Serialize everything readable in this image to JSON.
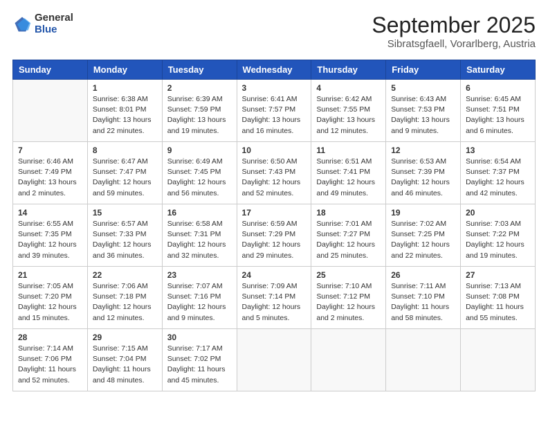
{
  "header": {
    "logo_general": "General",
    "logo_blue": "Blue",
    "month_title": "September 2025",
    "location": "Sibratsgfaell, Vorarlberg, Austria"
  },
  "calendar": {
    "weekdays": [
      "Sunday",
      "Monday",
      "Tuesday",
      "Wednesday",
      "Thursday",
      "Friday",
      "Saturday"
    ],
    "weeks": [
      [
        {
          "day": null
        },
        {
          "day": "1",
          "sunrise": "6:38 AM",
          "sunset": "8:01 PM",
          "daylight": "13 hours and 22 minutes."
        },
        {
          "day": "2",
          "sunrise": "6:39 AM",
          "sunset": "7:59 PM",
          "daylight": "13 hours and 19 minutes."
        },
        {
          "day": "3",
          "sunrise": "6:41 AM",
          "sunset": "7:57 PM",
          "daylight": "13 hours and 16 minutes."
        },
        {
          "day": "4",
          "sunrise": "6:42 AM",
          "sunset": "7:55 PM",
          "daylight": "13 hours and 12 minutes."
        },
        {
          "day": "5",
          "sunrise": "6:43 AM",
          "sunset": "7:53 PM",
          "daylight": "13 hours and 9 minutes."
        },
        {
          "day": "6",
          "sunrise": "6:45 AM",
          "sunset": "7:51 PM",
          "daylight": "13 hours and 6 minutes."
        }
      ],
      [
        {
          "day": "7",
          "sunrise": "6:46 AM",
          "sunset": "7:49 PM",
          "daylight": "13 hours and 2 minutes."
        },
        {
          "day": "8",
          "sunrise": "6:47 AM",
          "sunset": "7:47 PM",
          "daylight": "12 hours and 59 minutes."
        },
        {
          "day": "9",
          "sunrise": "6:49 AM",
          "sunset": "7:45 PM",
          "daylight": "12 hours and 56 minutes."
        },
        {
          "day": "10",
          "sunrise": "6:50 AM",
          "sunset": "7:43 PM",
          "daylight": "12 hours and 52 minutes."
        },
        {
          "day": "11",
          "sunrise": "6:51 AM",
          "sunset": "7:41 PM",
          "daylight": "12 hours and 49 minutes."
        },
        {
          "day": "12",
          "sunrise": "6:53 AM",
          "sunset": "7:39 PM",
          "daylight": "12 hours and 46 minutes."
        },
        {
          "day": "13",
          "sunrise": "6:54 AM",
          "sunset": "7:37 PM",
          "daylight": "12 hours and 42 minutes."
        }
      ],
      [
        {
          "day": "14",
          "sunrise": "6:55 AM",
          "sunset": "7:35 PM",
          "daylight": "12 hours and 39 minutes."
        },
        {
          "day": "15",
          "sunrise": "6:57 AM",
          "sunset": "7:33 PM",
          "daylight": "12 hours and 36 minutes."
        },
        {
          "day": "16",
          "sunrise": "6:58 AM",
          "sunset": "7:31 PM",
          "daylight": "12 hours and 32 minutes."
        },
        {
          "day": "17",
          "sunrise": "6:59 AM",
          "sunset": "7:29 PM",
          "daylight": "12 hours and 29 minutes."
        },
        {
          "day": "18",
          "sunrise": "7:01 AM",
          "sunset": "7:27 PM",
          "daylight": "12 hours and 25 minutes."
        },
        {
          "day": "19",
          "sunrise": "7:02 AM",
          "sunset": "7:25 PM",
          "daylight": "12 hours and 22 minutes."
        },
        {
          "day": "20",
          "sunrise": "7:03 AM",
          "sunset": "7:22 PM",
          "daylight": "12 hours and 19 minutes."
        }
      ],
      [
        {
          "day": "21",
          "sunrise": "7:05 AM",
          "sunset": "7:20 PM",
          "daylight": "12 hours and 15 minutes."
        },
        {
          "day": "22",
          "sunrise": "7:06 AM",
          "sunset": "7:18 PM",
          "daylight": "12 hours and 12 minutes."
        },
        {
          "day": "23",
          "sunrise": "7:07 AM",
          "sunset": "7:16 PM",
          "daylight": "12 hours and 9 minutes."
        },
        {
          "day": "24",
          "sunrise": "7:09 AM",
          "sunset": "7:14 PM",
          "daylight": "12 hours and 5 minutes."
        },
        {
          "day": "25",
          "sunrise": "7:10 AM",
          "sunset": "7:12 PM",
          "daylight": "12 hours and 2 minutes."
        },
        {
          "day": "26",
          "sunrise": "7:11 AM",
          "sunset": "7:10 PM",
          "daylight": "11 hours and 58 minutes."
        },
        {
          "day": "27",
          "sunrise": "7:13 AM",
          "sunset": "7:08 PM",
          "daylight": "11 hours and 55 minutes."
        }
      ],
      [
        {
          "day": "28",
          "sunrise": "7:14 AM",
          "sunset": "7:06 PM",
          "daylight": "11 hours and 52 minutes."
        },
        {
          "day": "29",
          "sunrise": "7:15 AM",
          "sunset": "7:04 PM",
          "daylight": "11 hours and 48 minutes."
        },
        {
          "day": "30",
          "sunrise": "7:17 AM",
          "sunset": "7:02 PM",
          "daylight": "11 hours and 45 minutes."
        },
        {
          "day": null
        },
        {
          "day": null
        },
        {
          "day": null
        },
        {
          "day": null
        }
      ]
    ]
  }
}
